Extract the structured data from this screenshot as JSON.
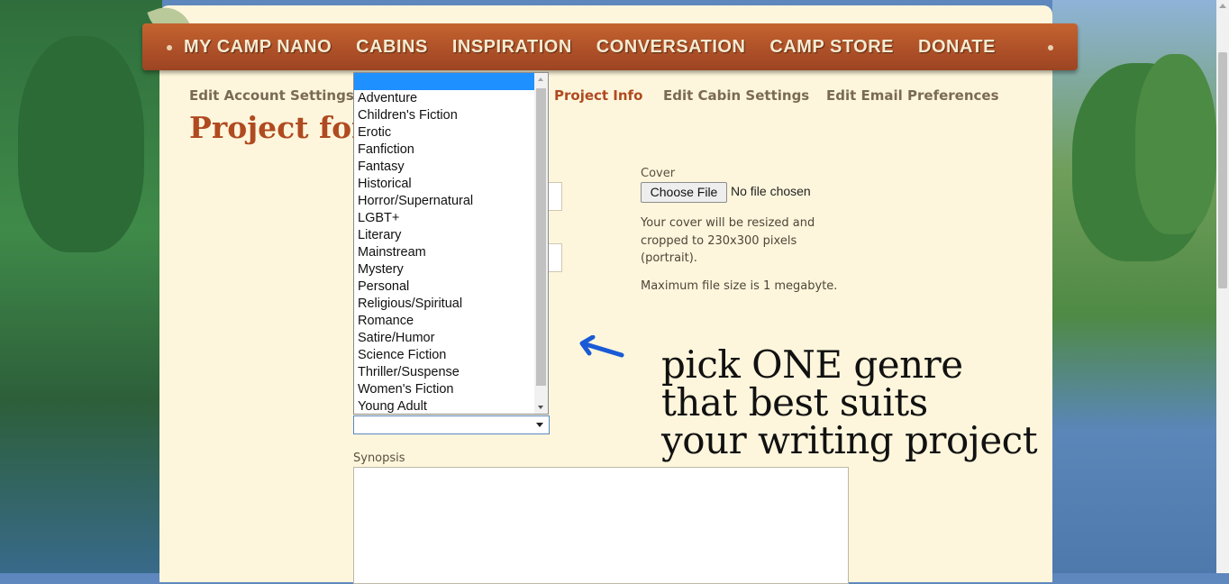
{
  "nav": {
    "items": [
      "MY CAMP NANO",
      "CABINS",
      "INSPIRATION",
      "CONVERSATION",
      "CAMP STORE",
      "DONATE"
    ]
  },
  "subnav": {
    "edit_account": "Edit Account Settings",
    "project_info": "Project Info",
    "edit_cabin": "Edit Cabin Settings",
    "edit_email": "Edit Email Preferences"
  },
  "page_title": "Project for",
  "cover": {
    "label": "Cover",
    "button_label": "Choose File",
    "status": "No file chosen",
    "resize_note": "Your cover will be resized and cropped to 230x300 pixels (portrait).",
    "size_note": "Maximum file size is 1 megabyte."
  },
  "genre_dropdown": {
    "selected_value": "",
    "options": [
      "",
      "Adventure",
      "Children's Fiction",
      "Erotic",
      "Fanfiction",
      "Fantasy",
      "Historical",
      "Horror/Supernatural",
      "LGBT+",
      "Literary",
      "Mainstream",
      "Mystery",
      "Personal",
      "Religious/Spiritual",
      "Romance",
      "Satire/Humor",
      "Science Fiction",
      "Thriller/Suspense",
      "Women's Fiction",
      "Young Adult"
    ]
  },
  "synopsis": {
    "label": "Synopsis",
    "value": ""
  },
  "annotation": {
    "lines": [
      "pick ONE genre",
      "that best suits",
      "your writing project"
    ],
    "arrow_color": "#1a5ad6"
  },
  "colors": {
    "accent": "#b04a20",
    "panel": "#fdf6dc",
    "selection": "#1e90ff"
  }
}
